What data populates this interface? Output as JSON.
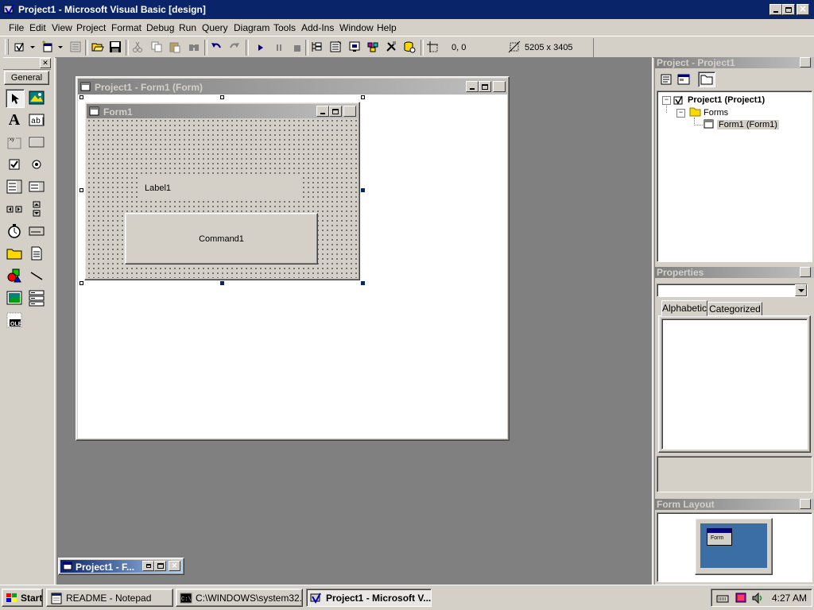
{
  "app": {
    "title": "Project1 - Microsoft Visual Basic [design]"
  },
  "menu": {
    "items": [
      {
        "label": "File"
      },
      {
        "label": "Edit"
      },
      {
        "label": "View"
      },
      {
        "label": "Project"
      },
      {
        "label": "Format"
      },
      {
        "label": "Debug"
      },
      {
        "label": "Run"
      },
      {
        "label": "Query"
      },
      {
        "label": "Diagram"
      },
      {
        "label": "Tools"
      },
      {
        "label": "Add-Ins"
      },
      {
        "label": "Window"
      },
      {
        "label": "Help"
      }
    ]
  },
  "toolbar": {
    "position_readout": "0, 0",
    "size_readout": "5205 x 3405"
  },
  "toolbox": {
    "tab_label": "General"
  },
  "designer": {
    "window_title": "Project1 - Form1 (Form)",
    "form_title": "Form1",
    "label_text": "Label1",
    "command_text": "Command1"
  },
  "project_explorer": {
    "title": "Project - Project1",
    "root": "Project1 (Project1)",
    "folder": "Forms",
    "item": "Form1 (Form1)"
  },
  "properties": {
    "title": "Properties",
    "tab_alphabetic": "Alphabetic",
    "tab_categorized": "Categorized"
  },
  "form_layout": {
    "title": "Form Layout",
    "mini_label": "Form"
  },
  "minimized_window": {
    "title": "Project1 - F..."
  },
  "taskbar": {
    "start_label": "Start",
    "tasks": [
      {
        "label": "README - Notepad"
      },
      {
        "label": "C:\\WINDOWS\\system32..."
      },
      {
        "label": "Project1 - Microsoft V..."
      }
    ],
    "clock": "4:27 AM"
  },
  "colors": {
    "title_active": "#0a246a",
    "mdi_background": "#808080",
    "face": "#d4d0c8",
    "desktop_blue": "#3a6ea5"
  }
}
